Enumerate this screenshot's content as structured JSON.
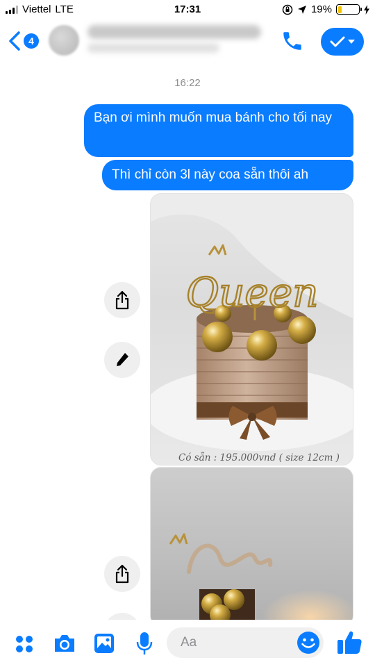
{
  "status_bar": {
    "carrier": "Viettel",
    "network": "LTE",
    "time": "17:31",
    "battery": "19%"
  },
  "header": {
    "back_count": "4",
    "contact_name": "",
    "contact_status": ""
  },
  "conversation": {
    "timestamp": "16:22",
    "messages": [
      {
        "text": "Bạn ơi mình muốn mua bánh cho tối nay"
      },
      {
        "text": "Thì chỉ còn 3l này coa sẵn thôi ah"
      }
    ],
    "photos": [
      {
        "topper": "Queen",
        "caption": "Có sẵn : 195.000vnd ( size 12cm )"
      },
      {
        "topper": ""
      }
    ]
  },
  "composer": {
    "placeholder": "Aa"
  },
  "colors": {
    "accent": "#0a7cff",
    "gold": "#c9a227"
  },
  "icons": [
    "back-chevron-icon",
    "phone-icon",
    "checkmark-icon",
    "chevron-down-icon",
    "share-icon",
    "pen-icon",
    "apps-icon",
    "camera-icon",
    "image-icon",
    "microphone-icon",
    "emoji-icon",
    "thumbs-up-icon"
  ]
}
